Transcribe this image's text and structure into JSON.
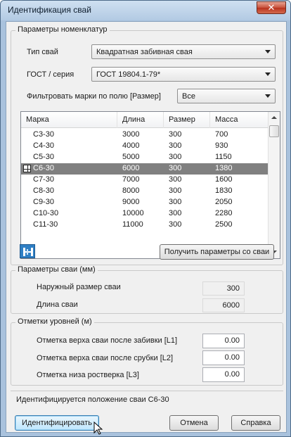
{
  "window": {
    "title": "Идентификация свай",
    "close_glyph": "✕"
  },
  "nomenclature": {
    "group_label": "Параметры номенклатур",
    "pile_type_label": "Тип свай",
    "pile_type_value": "Квадратная забивная свая",
    "gost_label": "ГОСТ / серия",
    "gost_value": "ГОСТ 19804.1-79*",
    "filter_label": "Фильтровать марки по полю [Размер]",
    "filter_value": "Все"
  },
  "table": {
    "columns": [
      "Марка",
      "Длина",
      "Размер",
      "Масса"
    ],
    "rows": [
      [
        "С3-30",
        "3000",
        "300",
        "700"
      ],
      [
        "С4-30",
        "4000",
        "300",
        "930"
      ],
      [
        "С5-30",
        "5000",
        "300",
        "1150"
      ],
      [
        "С6-30",
        "6000",
        "300",
        "1380"
      ],
      [
        "С7-30",
        "7000",
        "300",
        "1600"
      ],
      [
        "С8-30",
        "8000",
        "300",
        "1830"
      ],
      [
        "С9-30",
        "9000",
        "300",
        "2050"
      ],
      [
        "С10-30",
        "10000",
        "300",
        "2280"
      ],
      [
        "С11-30",
        "11000",
        "300",
        "2500"
      ]
    ],
    "selected_row": 3
  },
  "get_params_button": "Получить параметры со сваи",
  "pile_params": {
    "group_label": "Параметры сваи (мм)",
    "outer_size_label": "Наружный размер сваи",
    "outer_size_value": "300",
    "length_label": "Длина сваи",
    "length_value": "6000"
  },
  "levels": {
    "group_label": "Отметки уровней (м)",
    "top_after_driving_label": "Отметка верха сваи после забивки [L1]",
    "top_after_driving_value": "0.00",
    "top_after_cutting_label": "Отметка верха сваи после срубки [L2]",
    "top_after_cutting_value": "0.00",
    "grillage_bottom_label": "Отметка низа ростверка [L3]",
    "grillage_bottom_value": "0.00"
  },
  "status": "Идентифицируется положение сваи С6-30",
  "buttons": {
    "identify": "Идентифицировать",
    "cancel": "Отмена",
    "help": "Справка"
  },
  "colors": {
    "selection": "#808080",
    "logo_blue": "#2f7fc4"
  }
}
